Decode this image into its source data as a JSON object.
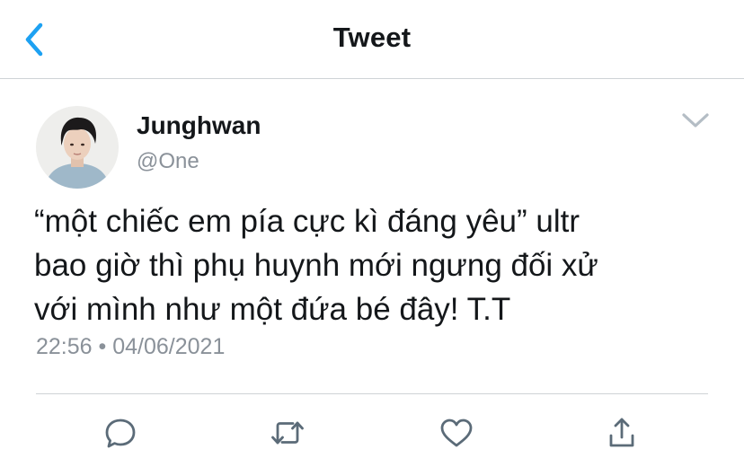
{
  "nav": {
    "title": "Tweet",
    "back_icon": "chevron-left-icon"
  },
  "tweet": {
    "author": {
      "display_name": "Junghwan",
      "handle": "@One"
    },
    "text_lines": [
      "“một chiếc em pía cực kì đáng yêu” ultr",
      "bao giờ thì phụ huynh mới ngưng đối xử",
      "với mình như một đứa bé đây! T.T"
    ],
    "time": "22:56",
    "separator": "•",
    "date": "04/06/2021"
  },
  "actions": [
    {
      "icon": "reply-icon"
    },
    {
      "icon": "retweet-icon"
    },
    {
      "icon": "like-icon"
    },
    {
      "icon": "share-icon"
    }
  ],
  "colors": {
    "accent": "#1da1f2",
    "text": "#14171a",
    "secondary": "#8a9199",
    "icon": "#5b6b78",
    "divider": "#cfd3d6"
  }
}
